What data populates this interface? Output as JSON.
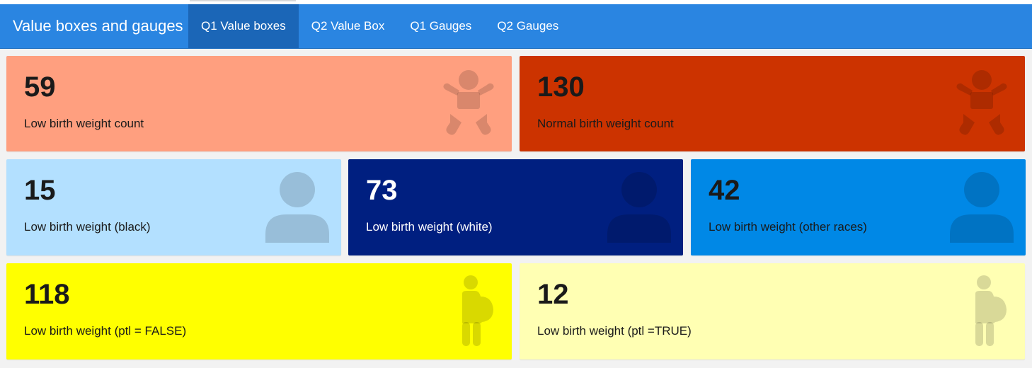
{
  "navbar": {
    "brand": "Value boxes and gauges",
    "tabs": [
      {
        "label": "Q1 Value boxes",
        "active": true
      },
      {
        "label": "Q2 Value Box",
        "active": false
      },
      {
        "label": "Q1 Gauges",
        "active": false
      },
      {
        "label": "Q2 Gauges",
        "active": false
      }
    ],
    "color": "#2a85e1",
    "active_color": "#1b66b7"
  },
  "value_boxes": [
    {
      "value": "59",
      "caption": "Low birth weight count",
      "icon": "baby-icon",
      "color": "#ff9f7f"
    },
    {
      "value": "130",
      "caption": "Normal birth weight count",
      "icon": "baby-icon",
      "color": "#cc3300"
    },
    {
      "value": "15",
      "caption": "Low birth weight (black)",
      "icon": "user-icon",
      "color": "#b3e0ff"
    },
    {
      "value": "73",
      "caption": "Low birth weight (white)",
      "icon": "user-icon",
      "color": "#001f80"
    },
    {
      "value": "42",
      "caption": "Low birth weight (other races)",
      "icon": "user-icon",
      "color": "#0088e6"
    },
    {
      "value": "118",
      "caption": "Low birth weight (ptl = FALSE)",
      "icon": "pregnant-icon",
      "color": "#ffff00"
    },
    {
      "value": "12",
      "caption": "Low birth weight (ptl =TRUE)",
      "icon": "pregnant-icon",
      "color": "#ffffb3"
    }
  ]
}
